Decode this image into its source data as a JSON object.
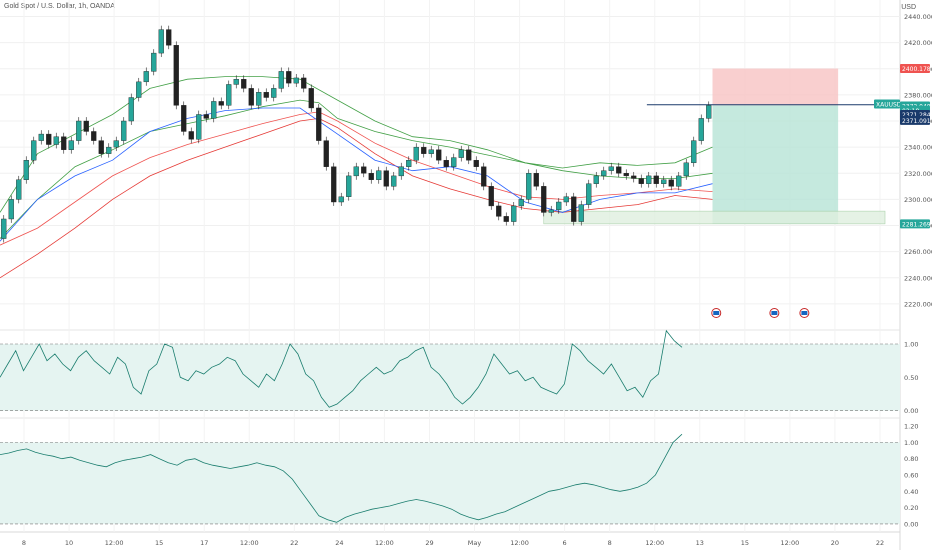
{
  "header": {
    "symbol_title": "Gold Spot / U.S. Dollar, 1h, OANDA",
    "currency": "USD"
  },
  "colors": {
    "up": "#26a69a",
    "down": "#ef5350",
    "candle": "#222222",
    "ema_fast": "#ef5350",
    "ema_mid": "#2962ff",
    "ema_slow": "#e53935",
    "band": "#43a047",
    "stop_zone": "#f8c3c3",
    "target_zone": "#b7e4d6",
    "support_zone": "#dff0df",
    "indicator_line": "#1a7d6e",
    "indicator_fill": "#e5f4f1",
    "target_level_line": "#1a3a6b"
  },
  "chart_data": {
    "type": "line",
    "title": "Gold Spot / U.S. Dollar, 1h, OANDA",
    "xlabel": "",
    "ylabel": "",
    "ylim": [
      2200,
      2445
    ],
    "grid": true,
    "x_ticks": [
      "8",
      "10",
      "12:00",
      "15",
      "17",
      "12:00",
      "22",
      "24",
      "12:00",
      "29",
      "May",
      "12:00",
      "6",
      "8",
      "12:00",
      "13",
      "15",
      "12:00",
      "20",
      "22"
    ],
    "y_ticks": [
      "2440.000",
      "2420.000",
      "2400.000",
      "2380.000",
      "2360.000",
      "2340.000",
      "2320.000",
      "2300.000",
      "2280.000",
      "2260.000",
      "2240.000",
      "2220.000"
    ],
    "price_labels": [
      {
        "label": "2400.178",
        "value": 2400.178,
        "color": "#ef5350"
      },
      {
        "label": "XAUUSD",
        "value": 2373,
        "color": "#26a69a"
      },
      {
        "label": "2372.040",
        "value": 2371.5,
        "color": "#26a69a"
      },
      {
        "label": "02:18",
        "value": 2368.2,
        "color": "#26a69a"
      },
      {
        "label": "2371.284",
        "value": 2365,
        "color": "#1a3a6b"
      },
      {
        "label": "2371.091",
        "value": 2360.5,
        "color": "#1a3a6b"
      },
      {
        "label": "2281.269",
        "value": 2281.269,
        "color": "#26a69a"
      }
    ],
    "price_path": [
      {
        "x": 0,
        "y": 2270
      },
      {
        "x": 4,
        "y": 2285
      },
      {
        "x": 8,
        "y": 2300
      },
      {
        "x": 12,
        "y": 2315
      },
      {
        "x": 16,
        "y": 2330
      },
      {
        "x": 20,
        "y": 2345
      },
      {
        "x": 24,
        "y": 2350
      },
      {
        "x": 28,
        "y": 2342
      },
      {
        "x": 32,
        "y": 2348
      },
      {
        "x": 36,
        "y": 2338
      },
      {
        "x": 40,
        "y": 2345
      },
      {
        "x": 44,
        "y": 2360
      },
      {
        "x": 48,
        "y": 2352
      },
      {
        "x": 52,
        "y": 2345
      },
      {
        "x": 56,
        "y": 2335
      },
      {
        "x": 60,
        "y": 2340
      },
      {
        "x": 64,
        "y": 2345
      },
      {
        "x": 68,
        "y": 2360
      },
      {
        "x": 72,
        "y": 2378
      },
      {
        "x": 76,
        "y": 2390
      },
      {
        "x": 80,
        "y": 2398
      },
      {
        "x": 84,
        "y": 2412
      },
      {
        "x": 88,
        "y": 2430
      },
      {
        "x": 92,
        "y": 2418
      },
      {
        "x": 96,
        "y": 2372
      },
      {
        "x": 100,
        "y": 2352
      },
      {
        "x": 104,
        "y": 2346
      },
      {
        "x": 108,
        "y": 2365
      },
      {
        "x": 112,
        "y": 2362
      },
      {
        "x": 116,
        "y": 2375
      },
      {
        "x": 120,
        "y": 2372
      },
      {
        "x": 124,
        "y": 2388
      },
      {
        "x": 128,
        "y": 2392
      },
      {
        "x": 132,
        "y": 2385
      },
      {
        "x": 136,
        "y": 2372
      },
      {
        "x": 140,
        "y": 2382
      },
      {
        "x": 144,
        "y": 2378
      },
      {
        "x": 148,
        "y": 2385
      },
      {
        "x": 152,
        "y": 2398
      },
      {
        "x": 156,
        "y": 2389
      },
      {
        "x": 160,
        "y": 2393
      },
      {
        "x": 164,
        "y": 2385
      },
      {
        "x": 168,
        "y": 2370
      },
      {
        "x": 172,
        "y": 2345
      },
      {
        "x": 176,
        "y": 2325
      },
      {
        "x": 180,
        "y": 2298
      },
      {
        "x": 184,
        "y": 2302
      },
      {
        "x": 188,
        "y": 2318
      },
      {
        "x": 192,
        "y": 2325
      },
      {
        "x": 196,
        "y": 2320
      },
      {
        "x": 200,
        "y": 2315
      },
      {
        "x": 204,
        "y": 2322
      },
      {
        "x": 208,
        "y": 2310
      },
      {
        "x": 212,
        "y": 2318
      },
      {
        "x": 216,
        "y": 2325
      },
      {
        "x": 220,
        "y": 2330
      },
      {
        "x": 224,
        "y": 2340
      },
      {
        "x": 228,
        "y": 2335
      },
      {
        "x": 232,
        "y": 2338
      },
      {
        "x": 236,
        "y": 2330
      },
      {
        "x": 240,
        "y": 2325
      },
      {
        "x": 244,
        "y": 2332
      },
      {
        "x": 248,
        "y": 2338
      },
      {
        "x": 252,
        "y": 2330
      },
      {
        "x": 256,
        "y": 2325
      },
      {
        "x": 260,
        "y": 2310
      },
      {
        "x": 264,
        "y": 2295
      },
      {
        "x": 268,
        "y": 2287
      },
      {
        "x": 272,
        "y": 2283
      },
      {
        "x": 276,
        "y": 2295
      },
      {
        "x": 280,
        "y": 2300
      },
      {
        "x": 284,
        "y": 2320
      },
      {
        "x": 288,
        "y": 2310
      },
      {
        "x": 292,
        "y": 2290
      },
      {
        "x": 296,
        "y": 2292
      },
      {
        "x": 300,
        "y": 2298
      },
      {
        "x": 304,
        "y": 2302
      },
      {
        "x": 308,
        "y": 2283
      },
      {
        "x": 312,
        "y": 2296
      },
      {
        "x": 316,
        "y": 2312
      },
      {
        "x": 320,
        "y": 2318
      },
      {
        "x": 324,
        "y": 2322
      },
      {
        "x": 328,
        "y": 2325
      },
      {
        "x": 332,
        "y": 2320
      },
      {
        "x": 336,
        "y": 2318
      },
      {
        "x": 340,
        "y": 2316
      },
      {
        "x": 344,
        "y": 2312
      },
      {
        "x": 348,
        "y": 2318
      },
      {
        "x": 352,
        "y": 2312
      },
      {
        "x": 356,
        "y": 2315
      },
      {
        "x": 360,
        "y": 2310
      },
      {
        "x": 364,
        "y": 2318
      },
      {
        "x": 368,
        "y": 2328
      },
      {
        "x": 372,
        "y": 2345
      },
      {
        "x": 376,
        "y": 2362
      },
      {
        "x": 380,
        "y": 2372
      }
    ],
    "series": [
      {
        "points": [
          {
            "x": 0,
            "y": 2270
          },
          {
            "x": 20,
            "y": 2300
          },
          {
            "x": 40,
            "y": 2325
          },
          {
            "x": 60,
            "y": 2338
          },
          {
            "x": 80,
            "y": 2352
          },
          {
            "x": 100,
            "y": 2358
          },
          {
            "x": 120,
            "y": 2364
          },
          {
            "x": 140,
            "y": 2371
          },
          {
            "x": 160,
            "y": 2376
          },
          {
            "x": 170,
            "y": 2374
          },
          {
            "x": 180,
            "y": 2362
          },
          {
            "x": 200,
            "y": 2352
          },
          {
            "x": 220,
            "y": 2345
          },
          {
            "x": 240,
            "y": 2340
          },
          {
            "x": 260,
            "y": 2334
          },
          {
            "x": 280,
            "y": 2328
          },
          {
            "x": 300,
            "y": 2322
          },
          {
            "x": 320,
            "y": 2318
          },
          {
            "x": 340,
            "y": 2316
          },
          {
            "x": 360,
            "y": 2316
          },
          {
            "x": 380,
            "y": 2320
          }
        ]
      },
      {
        "points": [
          {
            "x": 0,
            "y": 2265
          },
          {
            "x": 20,
            "y": 2278
          },
          {
            "x": 40,
            "y": 2298
          },
          {
            "x": 60,
            "y": 2318
          },
          {
            "x": 80,
            "y": 2332
          },
          {
            "x": 100,
            "y": 2342
          },
          {
            "x": 120,
            "y": 2350
          },
          {
            "x": 140,
            "y": 2358
          },
          {
            "x": 160,
            "y": 2365
          },
          {
            "x": 170,
            "y": 2367
          },
          {
            "x": 180,
            "y": 2360
          },
          {
            "x": 200,
            "y": 2343
          },
          {
            "x": 220,
            "y": 2330
          },
          {
            "x": 240,
            "y": 2320
          },
          {
            "x": 260,
            "y": 2310
          },
          {
            "x": 280,
            "y": 2302
          },
          {
            "x": 300,
            "y": 2300
          },
          {
            "x": 320,
            "y": 2303
          },
          {
            "x": 340,
            "y": 2305
          },
          {
            "x": 360,
            "y": 2308
          },
          {
            "x": 380,
            "y": 2306
          }
        ]
      },
      {
        "points": [
          {
            "x": 0,
            "y": 2240
          },
          {
            "x": 20,
            "y": 2258
          },
          {
            "x": 40,
            "y": 2278
          },
          {
            "x": 60,
            "y": 2300
          },
          {
            "x": 80,
            "y": 2318
          },
          {
            "x": 100,
            "y": 2330
          },
          {
            "x": 120,
            "y": 2340
          },
          {
            "x": 140,
            "y": 2350
          },
          {
            "x": 160,
            "y": 2360
          },
          {
            "x": 170,
            "y": 2362
          },
          {
            "x": 180,
            "y": 2355
          },
          {
            "x": 200,
            "y": 2335
          },
          {
            "x": 220,
            "y": 2318
          },
          {
            "x": 240,
            "y": 2308
          },
          {
            "x": 260,
            "y": 2300
          },
          {
            "x": 280,
            "y": 2293
          },
          {
            "x": 300,
            "y": 2290
          },
          {
            "x": 320,
            "y": 2293
          },
          {
            "x": 340,
            "y": 2296
          },
          {
            "x": 360,
            "y": 2303
          },
          {
            "x": 380,
            "y": 2300
          }
        ]
      },
      {
        "points": [
          {
            "x": 0,
            "y": 2290
          },
          {
            "x": 20,
            "y": 2335
          },
          {
            "x": 40,
            "y": 2350
          },
          {
            "x": 60,
            "y": 2365
          },
          {
            "x": 80,
            "y": 2385
          },
          {
            "x": 100,
            "y": 2392
          },
          {
            "x": 120,
            "y": 2394
          },
          {
            "x": 140,
            "y": 2394
          },
          {
            "x": 160,
            "y": 2392
          },
          {
            "x": 180,
            "y": 2376
          },
          {
            "x": 200,
            "y": 2360
          },
          {
            "x": 220,
            "y": 2348
          },
          {
            "x": 240,
            "y": 2345
          },
          {
            "x": 260,
            "y": 2338
          },
          {
            "x": 280,
            "y": 2328
          },
          {
            "x": 300,
            "y": 2324
          },
          {
            "x": 320,
            "y": 2328
          },
          {
            "x": 340,
            "y": 2326
          },
          {
            "x": 360,
            "y": 2328
          },
          {
            "x": 380,
            "y": 2340
          }
        ]
      },
      {
        "points": [
          {
            "x": 0,
            "y": 2268
          },
          {
            "x": 20,
            "y": 2300
          },
          {
            "x": 40,
            "y": 2318
          },
          {
            "x": 60,
            "y": 2330
          },
          {
            "x": 80,
            "y": 2352
          },
          {
            "x": 100,
            "y": 2362
          },
          {
            "x": 120,
            "y": 2368
          },
          {
            "x": 140,
            "y": 2370
          },
          {
            "x": 160,
            "y": 2370
          },
          {
            "x": 180,
            "y": 2350
          },
          {
            "x": 200,
            "y": 2330
          },
          {
            "x": 220,
            "y": 2322
          },
          {
            "x": 240,
            "y": 2325
          },
          {
            "x": 260,
            "y": 2318
          },
          {
            "x": 280,
            "y": 2298
          },
          {
            "x": 300,
            "y": 2290
          },
          {
            "x": 320,
            "y": 2300
          },
          {
            "x": 340,
            "y": 2305
          },
          {
            "x": 360,
            "y": 2305
          },
          {
            "x": 380,
            "y": 2312
          }
        ]
      }
    ],
    "zones": [
      {
        "kind": "stop",
        "x_start": 380,
        "x_end": 447,
        "y_low": 2372,
        "y_high": 2400.178
      },
      {
        "kind": "target",
        "x_start": 380,
        "x_end": 447,
        "y_low": 2281.269,
        "y_high": 2372
      },
      {
        "kind": "support",
        "x_start": 290,
        "x_end": 472,
        "y_low": 2281.269,
        "y_high": 2291
      }
    ],
    "level_line": {
      "x_start": 345,
      "x_end": 485,
      "y": 2372.5
    },
    "event_icons": [
      {
        "x": 382
      },
      {
        "x": 413
      },
      {
        "x": 429
      }
    ],
    "indicators": [
      {
        "ylim": [
          -0.05,
          1.15
        ],
        "y_ticks": [
          "1.00",
          "0.50",
          "0.00"
        ],
        "levels": [
          1.0,
          0.0
        ],
        "values": [
          0.5,
          0.7,
          0.9,
          0.6,
          0.8,
          1.0,
          0.75,
          0.85,
          0.7,
          0.6,
          0.8,
          0.9,
          0.75,
          0.65,
          0.55,
          0.8,
          0.7,
          0.35,
          0.25,
          0.6,
          0.7,
          1.0,
          0.95,
          0.5,
          0.45,
          0.6,
          0.55,
          0.65,
          0.7,
          0.8,
          0.75,
          0.55,
          0.45,
          0.35,
          0.55,
          0.45,
          0.7,
          1.0,
          0.85,
          0.55,
          0.45,
          0.2,
          0.05,
          0.1,
          0.2,
          0.3,
          0.45,
          0.55,
          0.65,
          0.55,
          0.6,
          0.75,
          0.8,
          0.9,
          0.95,
          0.65,
          0.55,
          0.4,
          0.2,
          0.1,
          0.2,
          0.35,
          0.55,
          0.85,
          0.7,
          0.55,
          0.6,
          0.45,
          0.5,
          0.35,
          0.3,
          0.25,
          0.4,
          1.0,
          0.9,
          0.75,
          0.65,
          0.55,
          0.7,
          0.5,
          0.3,
          0.35,
          0.2,
          0.45,
          0.55,
          1.2,
          1.05,
          0.95
        ]
      },
      {
        "ylim": [
          -0.05,
          1.25
        ],
        "y_ticks": [
          "1.20",
          "1.00",
          "0.80",
          "0.60",
          "0.40",
          "0.20",
          "0.00"
        ],
        "levels": [
          1.0,
          0.0
        ],
        "values": [
          0.85,
          0.87,
          0.9,
          0.92,
          0.88,
          0.85,
          0.83,
          0.8,
          0.82,
          0.78,
          0.75,
          0.72,
          0.7,
          0.75,
          0.78,
          0.8,
          0.82,
          0.85,
          0.8,
          0.75,
          0.72,
          0.78,
          0.8,
          0.75,
          0.72,
          0.7,
          0.68,
          0.7,
          0.72,
          0.75,
          0.72,
          0.7,
          0.65,
          0.55,
          0.4,
          0.25,
          0.1,
          0.05,
          0.02,
          0.08,
          0.12,
          0.15,
          0.18,
          0.2,
          0.22,
          0.25,
          0.28,
          0.3,
          0.28,
          0.25,
          0.22,
          0.18,
          0.12,
          0.08,
          0.05,
          0.08,
          0.12,
          0.15,
          0.2,
          0.25,
          0.3,
          0.35,
          0.4,
          0.42,
          0.45,
          0.48,
          0.5,
          0.48,
          0.45,
          0.42,
          0.4,
          0.42,
          0.45,
          0.5,
          0.6,
          0.8,
          1.0,
          1.1
        ]
      }
    ]
  }
}
